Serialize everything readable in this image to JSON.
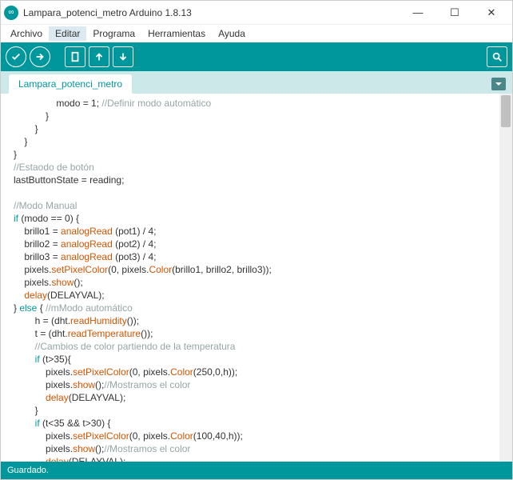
{
  "window": {
    "title": "Lampara_potenci_metro Arduino 1.8.13"
  },
  "menu": {
    "items": [
      "Archivo",
      "Editar",
      "Programa",
      "Herramientas",
      "Ayuda"
    ],
    "activeIndex": 1
  },
  "tab": {
    "name": "Lampara_potenci_metro"
  },
  "status": {
    "text": "Guardado."
  },
  "code": {
    "lines": [
      {
        "indent": 8,
        "tokens": [
          {
            "t": "modo = "
          },
          {
            "t": "1",
            "c": "num"
          },
          {
            "t": "; "
          },
          {
            "t": "//Definir modo automático",
            "c": "com"
          }
        ]
      },
      {
        "indent": 6,
        "tokens": [
          {
            "t": "}"
          }
        ]
      },
      {
        "indent": 4,
        "tokens": [
          {
            "t": "}"
          }
        ]
      },
      {
        "indent": 2,
        "tokens": [
          {
            "t": "}"
          }
        ]
      },
      {
        "indent": 0,
        "tokens": [
          {
            "t": "}"
          }
        ]
      },
      {
        "indent": 0,
        "tokens": [
          {
            "t": "//Estaodo de botón",
            "c": "com"
          }
        ]
      },
      {
        "indent": 0,
        "tokens": [
          {
            "t": "lastButtonState = reading;"
          }
        ]
      },
      {
        "indent": 0,
        "tokens": []
      },
      {
        "indent": 0,
        "tokens": [
          {
            "t": "//Modo Manual",
            "c": "com"
          }
        ]
      },
      {
        "indent": 0,
        "tokens": [
          {
            "t": "if",
            "c": "key"
          },
          {
            "t": " (modo == "
          },
          {
            "t": "0",
            "c": "num"
          },
          {
            "t": ") {"
          }
        ]
      },
      {
        "indent": 2,
        "tokens": [
          {
            "t": "brillo1 = "
          },
          {
            "t": "analogRead",
            "c": "orange"
          },
          {
            "t": " (pot1) / "
          },
          {
            "t": "4",
            "c": "num"
          },
          {
            "t": ";"
          }
        ]
      },
      {
        "indent": 2,
        "tokens": [
          {
            "t": "brillo2 = "
          },
          {
            "t": "analogRead",
            "c": "orange"
          },
          {
            "t": " (pot2) / "
          },
          {
            "t": "4",
            "c": "num"
          },
          {
            "t": ";"
          }
        ]
      },
      {
        "indent": 2,
        "tokens": [
          {
            "t": "brillo3 = "
          },
          {
            "t": "analogRead",
            "c": "orange"
          },
          {
            "t": " (pot3) / "
          },
          {
            "t": "4",
            "c": "num"
          },
          {
            "t": ";"
          }
        ]
      },
      {
        "indent": 2,
        "tokens": [
          {
            "t": "pixels."
          },
          {
            "t": "setPixelColor",
            "c": "orange"
          },
          {
            "t": "("
          },
          {
            "t": "0",
            "c": "num"
          },
          {
            "t": ", pixels."
          },
          {
            "t": "Color",
            "c": "orange"
          },
          {
            "t": "(brillo1, brillo2, brillo3));"
          }
        ]
      },
      {
        "indent": 2,
        "tokens": [
          {
            "t": "pixels."
          },
          {
            "t": "show",
            "c": "orange"
          },
          {
            "t": "();"
          }
        ]
      },
      {
        "indent": 2,
        "tokens": [
          {
            "t": "delay",
            "c": "orange"
          },
          {
            "t": "(DELAYVAL);"
          }
        ]
      },
      {
        "indent": 0,
        "tokens": [
          {
            "t": "} "
          },
          {
            "t": "else",
            "c": "key"
          },
          {
            "t": " { "
          },
          {
            "t": "//mModo automático",
            "c": "com"
          }
        ]
      },
      {
        "indent": 4,
        "tokens": [
          {
            "t": "h = (dht."
          },
          {
            "t": "readHumidity",
            "c": "orange"
          },
          {
            "t": "());"
          }
        ]
      },
      {
        "indent": 4,
        "tokens": [
          {
            "t": "t = (dht."
          },
          {
            "t": "readTemperature",
            "c": "orange"
          },
          {
            "t": "());"
          }
        ]
      },
      {
        "indent": 4,
        "tokens": [
          {
            "t": "//Cambios de color partiendo de la temperatura",
            "c": "com"
          }
        ]
      },
      {
        "indent": 4,
        "tokens": [
          {
            "t": "if",
            "c": "key"
          },
          {
            "t": " (t>"
          },
          {
            "t": "35",
            "c": "num"
          },
          {
            "t": "){"
          }
        ]
      },
      {
        "indent": 6,
        "tokens": [
          {
            "t": "pixels."
          },
          {
            "t": "setPixelColor",
            "c": "orange"
          },
          {
            "t": "("
          },
          {
            "t": "0",
            "c": "num"
          },
          {
            "t": ", pixels."
          },
          {
            "t": "Color",
            "c": "orange"
          },
          {
            "t": "("
          },
          {
            "t": "250",
            "c": "num"
          },
          {
            "t": ","
          },
          {
            "t": "0",
            "c": "num"
          },
          {
            "t": ",h));"
          }
        ]
      },
      {
        "indent": 6,
        "tokens": [
          {
            "t": "pixels."
          },
          {
            "t": "show",
            "c": "orange"
          },
          {
            "t": "();"
          },
          {
            "t": "//Mostramos el color",
            "c": "com"
          }
        ]
      },
      {
        "indent": 6,
        "tokens": [
          {
            "t": "delay",
            "c": "orange"
          },
          {
            "t": "(DELAYVAL);"
          }
        ]
      },
      {
        "indent": 4,
        "tokens": [
          {
            "t": "}"
          }
        ]
      },
      {
        "indent": 4,
        "tokens": [
          {
            "t": "if",
            "c": "key"
          },
          {
            "t": " (t<"
          },
          {
            "t": "35",
            "c": "num"
          },
          {
            "t": " && t>"
          },
          {
            "t": "30",
            "c": "num"
          },
          {
            "t": ") {"
          }
        ]
      },
      {
        "indent": 6,
        "tokens": [
          {
            "t": "pixels."
          },
          {
            "t": "setPixelColor",
            "c": "orange"
          },
          {
            "t": "("
          },
          {
            "t": "0",
            "c": "num"
          },
          {
            "t": ", pixels."
          },
          {
            "t": "Color",
            "c": "orange"
          },
          {
            "t": "("
          },
          {
            "t": "100",
            "c": "num"
          },
          {
            "t": ","
          },
          {
            "t": "40",
            "c": "num"
          },
          {
            "t": ",h));"
          }
        ]
      },
      {
        "indent": 6,
        "tokens": [
          {
            "t": "pixels."
          },
          {
            "t": "show",
            "c": "orange"
          },
          {
            "t": "();"
          },
          {
            "t": "//Mostramos el color",
            "c": "com"
          }
        ]
      },
      {
        "indent": 6,
        "tokens": [
          {
            "t": "delay",
            "c": "orange"
          },
          {
            "t": "(DELAYVAL);"
          }
        ]
      }
    ]
  }
}
